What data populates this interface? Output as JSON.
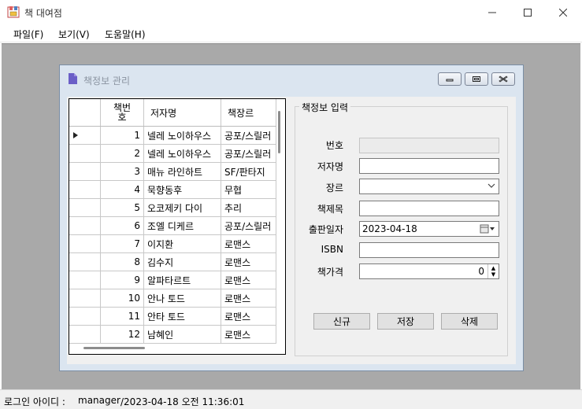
{
  "window": {
    "title": "책 대여점"
  },
  "menu": {
    "file": "파일(F)",
    "view": "보기(V)",
    "help": "도움말(H)"
  },
  "child": {
    "title": "책정보 관리"
  },
  "grid": {
    "headers": {
      "col1": "책번\n호",
      "col2": "저자명",
      "col3": "책장르"
    },
    "rows": [
      {
        "num": "1",
        "author": "넬레 노이하우스",
        "genre": "공포/스릴러"
      },
      {
        "num": "2",
        "author": "넬레 노이하우스",
        "genre": "공포/스릴러"
      },
      {
        "num": "3",
        "author": "매뉴 라인하트",
        "genre": "SF/판타지"
      },
      {
        "num": "4",
        "author": "묵향동후",
        "genre": "무협"
      },
      {
        "num": "5",
        "author": "오코제키 다이",
        "genre": "추리"
      },
      {
        "num": "6",
        "author": "조엘 디케르",
        "genre": "공포/스릴러"
      },
      {
        "num": "7",
        "author": "이지환",
        "genre": "로맨스"
      },
      {
        "num": "8",
        "author": "김수지",
        "genre": "로맨스"
      },
      {
        "num": "9",
        "author": "알파타르트",
        "genre": "로맨스"
      },
      {
        "num": "10",
        "author": "안나 토드",
        "genre": "로맨스"
      },
      {
        "num": "11",
        "author": "안타 토드",
        "genre": "로맨스"
      },
      {
        "num": "12",
        "author": "남혜인",
        "genre": "로맨스"
      }
    ]
  },
  "form": {
    "group_title": "책정보 입력",
    "labels": {
      "number": "번호",
      "author": "저자명",
      "genre": "장르",
      "title": "책제목",
      "pubdate": "출판일자",
      "isbn": "ISBN",
      "price": "책가격"
    },
    "values": {
      "number": "",
      "author": "",
      "genre": "",
      "title": "",
      "pubdate": "2023-04-18",
      "isbn": "",
      "price": "0"
    },
    "buttons": {
      "new": "신규",
      "save": "저장",
      "delete": "삭제"
    }
  },
  "status": {
    "login_label": "로그인 아이디 :",
    "user": "manager",
    "datetime": "/2023-04-18 오전 11:36:01"
  }
}
